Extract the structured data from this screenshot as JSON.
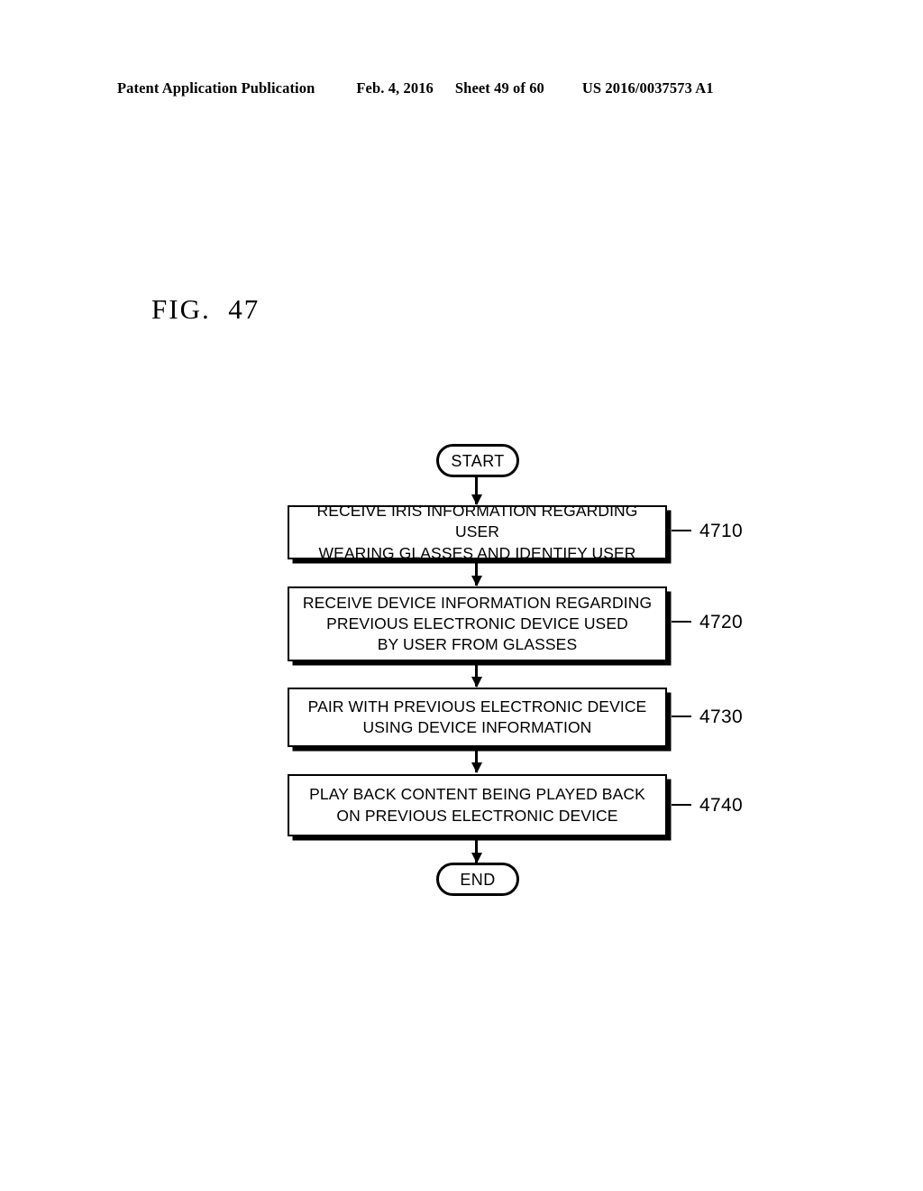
{
  "header": {
    "publication": "Patent Application Publication",
    "date": "Feb. 4, 2016",
    "sheet": "Sheet 49 of 60",
    "patent_number": "US 2016/0037573 A1"
  },
  "figure": {
    "label": "FIG.  47"
  },
  "flowchart": {
    "start_label": "START",
    "end_label": "END",
    "steps": [
      {
        "ref": "4710",
        "lines": [
          "RECEIVE IRIS INFORMATION REGARDING USER",
          "WEARING GLASSES AND IDENTIFY USER"
        ]
      },
      {
        "ref": "4720",
        "lines": [
          "RECEIVE DEVICE INFORMATION REGARDING",
          "PREVIOUS ELECTRONIC DEVICE USED",
          "BY USER FROM GLASSES"
        ]
      },
      {
        "ref": "4730",
        "lines": [
          "PAIR WITH PREVIOUS ELECTRONIC DEVICE",
          "USING DEVICE INFORMATION"
        ]
      },
      {
        "ref": "4740",
        "lines": [
          "PLAY BACK CONTENT BEING PLAYED BACK",
          "ON PREVIOUS ELECTRONIC DEVICE"
        ]
      }
    ]
  },
  "colors": {
    "ink": "#000000",
    "page": "#ffffff"
  }
}
